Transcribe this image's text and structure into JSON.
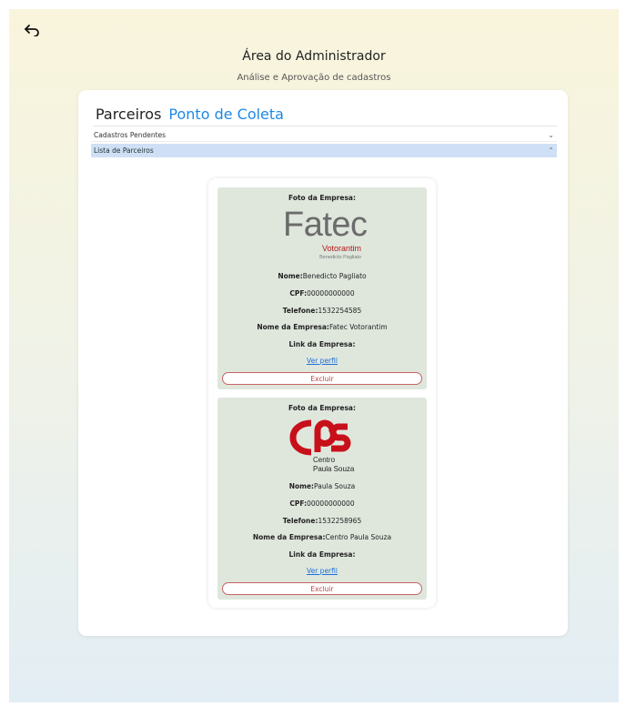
{
  "header": {
    "title": "Área do Administrador",
    "subtitle": "Análise e Aprovação de cadastros"
  },
  "tabs": [
    {
      "label": "Parceiros"
    },
    {
      "label": "Ponto de Coleta"
    }
  ],
  "accordion": {
    "pending": {
      "label": "Cadastros Pendentes"
    },
    "list": {
      "label": "Lista de Parceiros"
    }
  },
  "partners": [
    {
      "photo_label": "Foto da Empresa:",
      "logo_text": "Fatec",
      "logo_sub": "Votorantim",
      "logo_sub2": "Benedicto Pagliato",
      "name_label": "Nome:",
      "name": "Benedicto Pagliato",
      "cpf_label": "CPF:",
      "cpf": "00000000000",
      "phone_label": "Telefone:",
      "phone": "1532254585",
      "company_label": "Nome da Empresa:",
      "company": "Fatec Votorantim",
      "link_label": "Link da Empresa:",
      "link_text": "Ver perfil",
      "delete_label": "Excluir"
    },
    {
      "photo_label": "Foto da Empresa:",
      "logo_text": "Centro",
      "logo_sub": "Paula Souza",
      "name_label": "Nome:",
      "name": "Paula Souza",
      "cpf_label": "CPF:",
      "cpf": "00000000000",
      "phone_label": "Telefone:",
      "phone": "1532258965",
      "company_label": "Nome da Empresa:",
      "company": "Centro Paula Souza",
      "link_label": "Link da Empresa:",
      "link_text": "Ver perfil",
      "delete_label": "Excluir"
    }
  ],
  "colors": {
    "accent": "#1e88e5",
    "selected_row": "#cfe0f6",
    "card_bg": "#dfe7dd",
    "danger": "#c04040"
  }
}
